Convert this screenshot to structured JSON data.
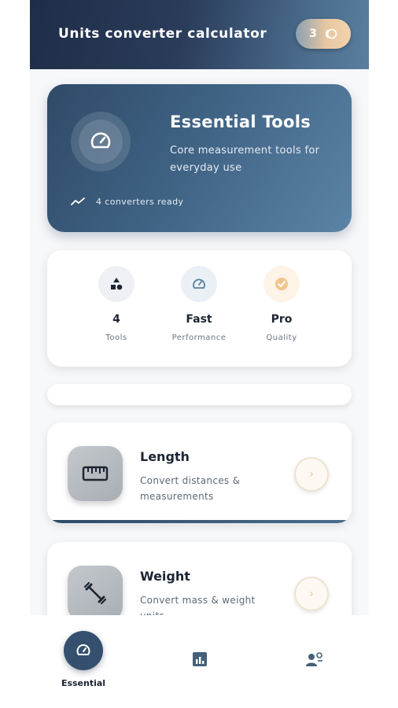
{
  "header": {
    "title": "Units converter calculator",
    "coins": "3",
    "coin_icon": "coin-stack-icon"
  },
  "hero": {
    "title": "Essential Tools",
    "subtitle": "Core measurement tools for everyday use",
    "status": "4 converters ready",
    "icon": "gauge-icon",
    "status_icon": "trend-line-icon"
  },
  "stats": [
    {
      "value": "4",
      "label": "Tools",
      "icon": "shapes-icon"
    },
    {
      "value": "Fast",
      "label": "Performance",
      "icon": "gauge-icon"
    },
    {
      "value": "Pro",
      "label": "Quality",
      "icon": "check-badge-icon"
    }
  ],
  "converters": [
    {
      "title": "Length",
      "subtitle": "Convert distances & measurements",
      "icon": "ruler-icon"
    },
    {
      "title": "Weight",
      "subtitle": "Convert mass & weight units",
      "icon": "dumbbell-icon"
    }
  ],
  "nav": {
    "essential_label": "Essential",
    "items": [
      "gauge-icon",
      "chart-icon",
      "users-icon"
    ]
  },
  "colors": {
    "primary": "#34506e",
    "accent": "#e9c392",
    "background": "#f7f8fa"
  }
}
